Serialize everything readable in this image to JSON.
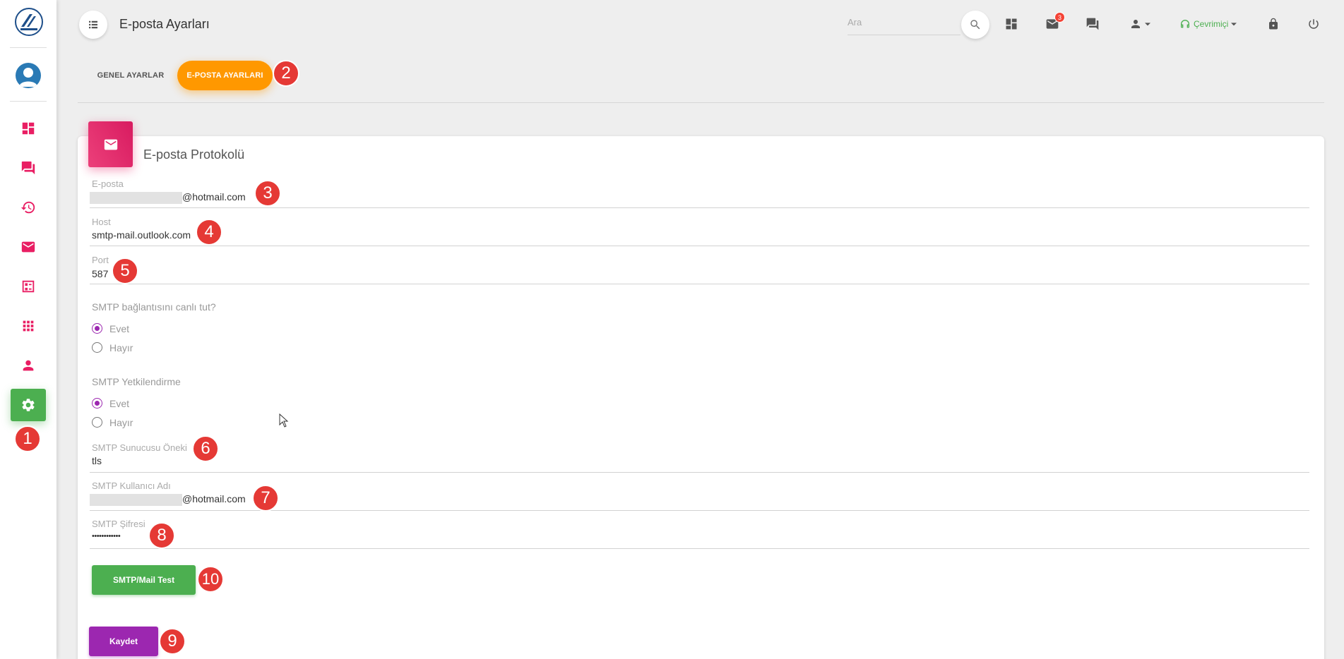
{
  "header": {
    "title": "E-posta Ayarları",
    "search_placeholder": "Ara",
    "notification_count": "3",
    "status": "Çevrimiçi"
  },
  "tabs": [
    {
      "label": "GENEL AYARLAR",
      "active": false
    },
    {
      "label": "E-POSTA AYARLARI",
      "active": true
    }
  ],
  "card": {
    "title": "E-posta Protokolü"
  },
  "fields": {
    "email": {
      "label": "E-posta",
      "value": "@hotmail.com"
    },
    "host": {
      "label": "Host",
      "value": "smtp-mail.outlook.com"
    },
    "port": {
      "label": "Port",
      "value": "587"
    },
    "keepalive": {
      "question": "SMTP bağlantısını canlı tut?",
      "yes": "Evet",
      "no": "Hayır",
      "selected": "Evet"
    },
    "auth": {
      "question": "SMTP Yetkilendirme",
      "yes": "Evet",
      "no": "Hayır",
      "selected": "Evet"
    },
    "prefix": {
      "label": "SMTP Sunucusu Öneki",
      "value": "tls"
    },
    "username": {
      "label": "SMTP Kullanıcı Adı",
      "value": "@hotmail.com"
    },
    "password": {
      "label": "SMTP Şifresi",
      "value": "••••••••••••"
    }
  },
  "buttons": {
    "test": "SMTP/Mail Test",
    "save": "Kaydet"
  },
  "annotations": [
    "1",
    "2",
    "3",
    "4",
    "5",
    "6",
    "7",
    "8",
    "9",
    "10"
  ],
  "colors": {
    "accent_pink": "#e91e63",
    "active_green": "#4caf50",
    "tab_orange": "#ff9800",
    "purple": "#9c27b0",
    "badge_red": "#e53935"
  }
}
